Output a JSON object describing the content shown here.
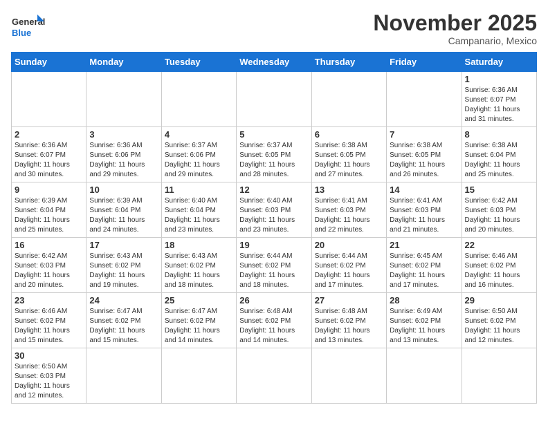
{
  "logo": {
    "text_general": "General",
    "text_blue": "Blue"
  },
  "title": "November 2025",
  "location": "Campanario, Mexico",
  "days_of_week": [
    "Sunday",
    "Monday",
    "Tuesday",
    "Wednesday",
    "Thursday",
    "Friday",
    "Saturday"
  ],
  "weeks": [
    [
      {
        "day": "",
        "info": ""
      },
      {
        "day": "",
        "info": ""
      },
      {
        "day": "",
        "info": ""
      },
      {
        "day": "",
        "info": ""
      },
      {
        "day": "",
        "info": ""
      },
      {
        "day": "",
        "info": ""
      },
      {
        "day": "1",
        "info": "Sunrise: 6:36 AM\nSunset: 6:07 PM\nDaylight: 11 hours\nand 31 minutes."
      }
    ],
    [
      {
        "day": "2",
        "info": "Sunrise: 6:36 AM\nSunset: 6:07 PM\nDaylight: 11 hours\nand 30 minutes."
      },
      {
        "day": "3",
        "info": "Sunrise: 6:36 AM\nSunset: 6:06 PM\nDaylight: 11 hours\nand 29 minutes."
      },
      {
        "day": "4",
        "info": "Sunrise: 6:37 AM\nSunset: 6:06 PM\nDaylight: 11 hours\nand 29 minutes."
      },
      {
        "day": "5",
        "info": "Sunrise: 6:37 AM\nSunset: 6:05 PM\nDaylight: 11 hours\nand 28 minutes."
      },
      {
        "day": "6",
        "info": "Sunrise: 6:38 AM\nSunset: 6:05 PM\nDaylight: 11 hours\nand 27 minutes."
      },
      {
        "day": "7",
        "info": "Sunrise: 6:38 AM\nSunset: 6:05 PM\nDaylight: 11 hours\nand 26 minutes."
      },
      {
        "day": "8",
        "info": "Sunrise: 6:38 AM\nSunset: 6:04 PM\nDaylight: 11 hours\nand 25 minutes."
      }
    ],
    [
      {
        "day": "9",
        "info": "Sunrise: 6:39 AM\nSunset: 6:04 PM\nDaylight: 11 hours\nand 25 minutes."
      },
      {
        "day": "10",
        "info": "Sunrise: 6:39 AM\nSunset: 6:04 PM\nDaylight: 11 hours\nand 24 minutes."
      },
      {
        "day": "11",
        "info": "Sunrise: 6:40 AM\nSunset: 6:04 PM\nDaylight: 11 hours\nand 23 minutes."
      },
      {
        "day": "12",
        "info": "Sunrise: 6:40 AM\nSunset: 6:03 PM\nDaylight: 11 hours\nand 23 minutes."
      },
      {
        "day": "13",
        "info": "Sunrise: 6:41 AM\nSunset: 6:03 PM\nDaylight: 11 hours\nand 22 minutes."
      },
      {
        "day": "14",
        "info": "Sunrise: 6:41 AM\nSunset: 6:03 PM\nDaylight: 11 hours\nand 21 minutes."
      },
      {
        "day": "15",
        "info": "Sunrise: 6:42 AM\nSunset: 6:03 PM\nDaylight: 11 hours\nand 20 minutes."
      }
    ],
    [
      {
        "day": "16",
        "info": "Sunrise: 6:42 AM\nSunset: 6:03 PM\nDaylight: 11 hours\nand 20 minutes."
      },
      {
        "day": "17",
        "info": "Sunrise: 6:43 AM\nSunset: 6:02 PM\nDaylight: 11 hours\nand 19 minutes."
      },
      {
        "day": "18",
        "info": "Sunrise: 6:43 AM\nSunset: 6:02 PM\nDaylight: 11 hours\nand 18 minutes."
      },
      {
        "day": "19",
        "info": "Sunrise: 6:44 AM\nSunset: 6:02 PM\nDaylight: 11 hours\nand 18 minutes."
      },
      {
        "day": "20",
        "info": "Sunrise: 6:44 AM\nSunset: 6:02 PM\nDaylight: 11 hours\nand 17 minutes."
      },
      {
        "day": "21",
        "info": "Sunrise: 6:45 AM\nSunset: 6:02 PM\nDaylight: 11 hours\nand 17 minutes."
      },
      {
        "day": "22",
        "info": "Sunrise: 6:46 AM\nSunset: 6:02 PM\nDaylight: 11 hours\nand 16 minutes."
      }
    ],
    [
      {
        "day": "23",
        "info": "Sunrise: 6:46 AM\nSunset: 6:02 PM\nDaylight: 11 hours\nand 15 minutes."
      },
      {
        "day": "24",
        "info": "Sunrise: 6:47 AM\nSunset: 6:02 PM\nDaylight: 11 hours\nand 15 minutes."
      },
      {
        "day": "25",
        "info": "Sunrise: 6:47 AM\nSunset: 6:02 PM\nDaylight: 11 hours\nand 14 minutes."
      },
      {
        "day": "26",
        "info": "Sunrise: 6:48 AM\nSunset: 6:02 PM\nDaylight: 11 hours\nand 14 minutes."
      },
      {
        "day": "27",
        "info": "Sunrise: 6:48 AM\nSunset: 6:02 PM\nDaylight: 11 hours\nand 13 minutes."
      },
      {
        "day": "28",
        "info": "Sunrise: 6:49 AM\nSunset: 6:02 PM\nDaylight: 11 hours\nand 13 minutes."
      },
      {
        "day": "29",
        "info": "Sunrise: 6:50 AM\nSunset: 6:02 PM\nDaylight: 11 hours\nand 12 minutes."
      }
    ],
    [
      {
        "day": "30",
        "info": "Sunrise: 6:50 AM\nSunset: 6:03 PM\nDaylight: 11 hours\nand 12 minutes."
      },
      {
        "day": "",
        "info": ""
      },
      {
        "day": "",
        "info": ""
      },
      {
        "day": "",
        "info": ""
      },
      {
        "day": "",
        "info": ""
      },
      {
        "day": "",
        "info": ""
      },
      {
        "day": "",
        "info": ""
      }
    ]
  ]
}
